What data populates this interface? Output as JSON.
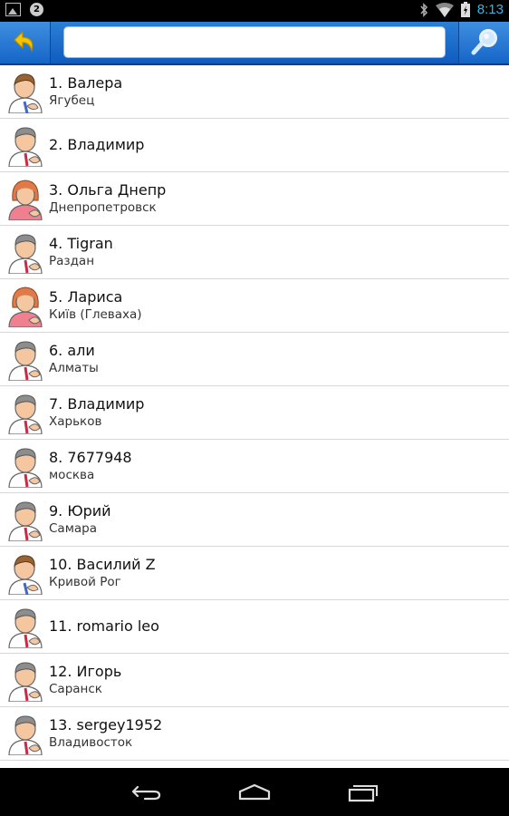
{
  "status_bar": {
    "notification_count": "2",
    "time": "8:13",
    "left_icons": [
      "image-icon",
      "notification-count-badge"
    ],
    "right_icons": [
      "bluetooth-icon",
      "wifi-icon",
      "battery-icon"
    ]
  },
  "toolbar": {
    "back_icon": "back-arrow-icon",
    "search_value": "",
    "search_placeholder": "",
    "search_icon": "magnifier-icon",
    "accent": "#1a6fd0"
  },
  "contacts": [
    {
      "name": "1. Валера",
      "city": "Ягубец",
      "avatar": "avatar-boy-icon"
    },
    {
      "name": "2. Владимир",
      "city": "",
      "avatar": "avatar-man-icon"
    },
    {
      "name": "3. Ольга Днепр",
      "city": "Днепропетровск",
      "avatar": "avatar-woman-icon"
    },
    {
      "name": "4. Tigran",
      "city": "Раздан",
      "avatar": "avatar-man-icon"
    },
    {
      "name": "5. Лариса",
      "city": "Київ (Глеваха)",
      "avatar": "avatar-woman-icon"
    },
    {
      "name": "6. али",
      "city": "Алматы",
      "avatar": "avatar-man-icon"
    },
    {
      "name": "7. Владимир",
      "city": "Харьков",
      "avatar": "avatar-man-icon"
    },
    {
      "name": "8. 7677948",
      "city": "москва",
      "avatar": "avatar-man-icon"
    },
    {
      "name": "9. Юрий",
      "city": "Самара",
      "avatar": "avatar-man-icon"
    },
    {
      "name": "10. Василий Z",
      "city": "Кривой Рог",
      "avatar": "avatar-boy-icon"
    },
    {
      "name": "11. romario leo",
      "city": "",
      "avatar": "avatar-man-icon"
    },
    {
      "name": "12. Игорь",
      "city": "Саранск",
      "avatar": "avatar-man-icon"
    },
    {
      "name": "13. sergey1952",
      "city": "Владивосток",
      "avatar": "avatar-man-icon"
    }
  ],
  "nav_bar": {
    "buttons": [
      "back-nav-icon",
      "home-nav-icon",
      "recent-apps-icon"
    ]
  }
}
